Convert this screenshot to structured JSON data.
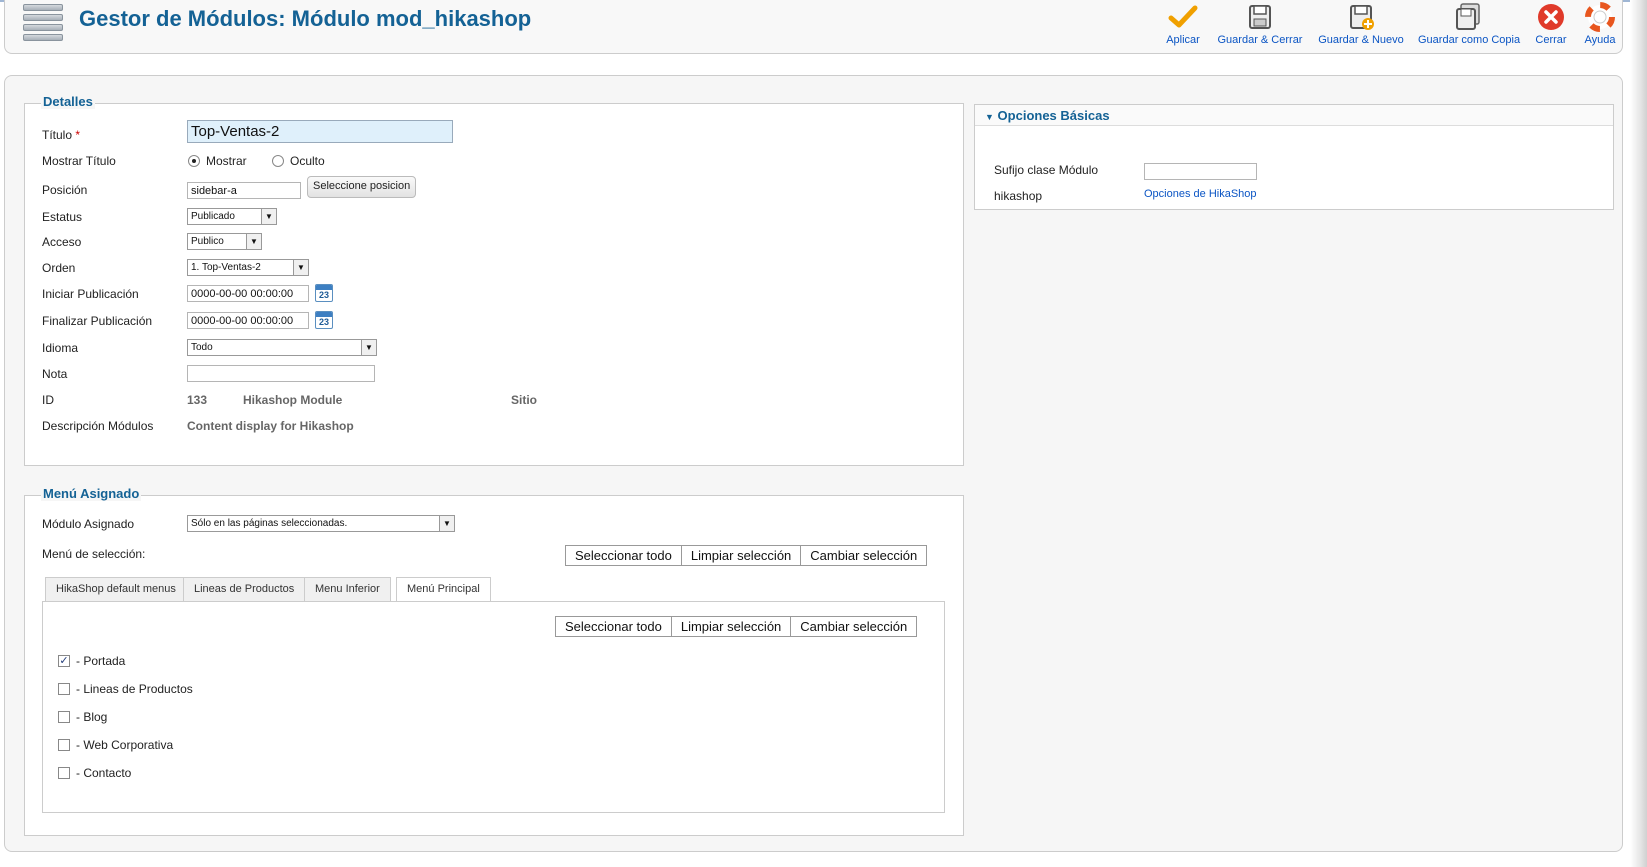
{
  "header": {
    "title": "Gestor de Módulos: Módulo mod_hikashop"
  },
  "toolbar": {
    "buttons": [
      {
        "label": "Aplicar",
        "icon": "check-icon"
      },
      {
        "label": "Guardar & Cerrar",
        "icon": "save-icon"
      },
      {
        "label": "Guardar & Nuevo",
        "icon": "save-new-icon"
      },
      {
        "label": "Guardar como Copia",
        "icon": "save-copy-icon"
      },
      {
        "label": "Cerrar",
        "icon": "close-icon"
      },
      {
        "label": "Ayuda",
        "icon": "help-icon"
      }
    ]
  },
  "details": {
    "legend": "Detalles",
    "titulo_label": "Título",
    "titulo_required": "*",
    "titulo_value": "Top-Ventas-2",
    "mostrar_titulo_label": "Mostrar Título",
    "mostrar_option": "Mostrar",
    "oculto_option": "Oculto",
    "posicion_label": "Posición",
    "posicion_value": "sidebar-a",
    "seleccione_posicion": "Seleccione posicion",
    "estatus_label": "Estatus",
    "estatus_value": "Publicado",
    "acceso_label": "Acceso",
    "acceso_value": "Publico",
    "orden_label": "Orden",
    "orden_value": "1. Top-Ventas-2",
    "iniciar_label": "Iniciar Publicación",
    "iniciar_value": "0000-00-00 00:00:00",
    "finalizar_label": "Finalizar Publicación",
    "finalizar_value": "0000-00-00 00:00:00",
    "calendar_day": "23",
    "idioma_label": "Idioma",
    "idioma_value": "Todo",
    "nota_label": "Nota",
    "nota_value": "",
    "id_label": "ID",
    "id_value": "133",
    "module_name": "Hikashop Module",
    "sitio": "Sitio",
    "descripcion_label": "Descripción Módulos",
    "descripcion_value": "Content display for Hikashop"
  },
  "menu": {
    "legend": "Menú Asignado",
    "modulo_asignado_label": "Módulo Asignado",
    "modulo_asignado_value": "Sólo en las páginas seleccionadas.",
    "menu_seleccion_label": "Menú de selección:",
    "select_all": "Seleccionar todo",
    "clear_selection": "Limpiar selección",
    "toggle_selection": "Cambiar selección",
    "tabs": [
      "HikaShop default menus",
      "Lineas de Productos",
      "Menu Inferior",
      "Menú Principal"
    ],
    "active_tab": "Menú Principal",
    "items": [
      {
        "label": "- Portada",
        "checked": "✓"
      },
      {
        "label": "- Lineas de Productos",
        "checked": ""
      },
      {
        "label": "- Blog",
        "checked": ""
      },
      {
        "label": "- Web Corporativa",
        "checked": ""
      },
      {
        "label": "- Contacto",
        "checked": ""
      }
    ]
  },
  "basic_options": {
    "title": "Opciones Básicas",
    "sufijo_label": "Sufijo clase Módulo",
    "sufijo_value": "",
    "hikashop_label": "hikashop",
    "hikashop_link": "Opciones de HikaShop"
  },
  "colors": {
    "title_blue": "#146295",
    "link_blue": "#0b55c4",
    "required_red": "#cc0000"
  }
}
